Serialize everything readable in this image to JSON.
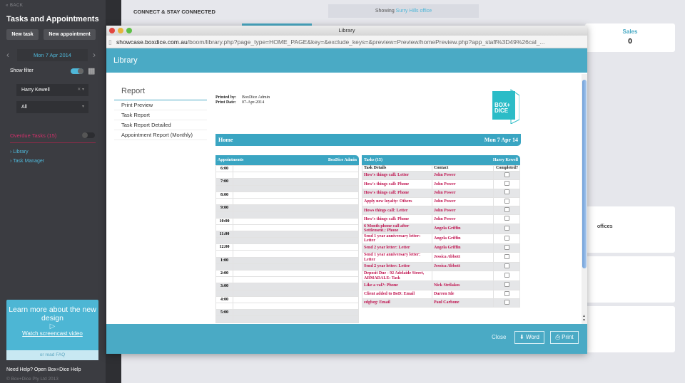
{
  "sidebar": {
    "back": "« BACK",
    "title": "Tasks and Appointments",
    "new_task": "New task",
    "new_appointment": "New appointment",
    "date": "Mon 7 Apr 2014",
    "show_filter": "Show filter",
    "staff_filter": "Harry Kewell",
    "type_filter": "All",
    "overdue": "Overdue Tasks (15)",
    "links": [
      "Library",
      "Task Manager"
    ],
    "promo": {
      "title": "Learn more about the new design",
      "video": "Watch screencast video",
      "faq": "or read FAQ"
    },
    "help": "Need Help? Open Box+Dice Help",
    "copyright": "© Box+Dice Pty Ltd 2013"
  },
  "main": {
    "header": "CONNECT & STAY CONNECTED",
    "showing_prefix": "Showing",
    "showing_office": "Surry Hills office",
    "sales_label": "Sales",
    "sales_value": "0",
    "offices_text": "offices"
  },
  "window": {
    "title": "Library",
    "url_domain": "showcase.boxdice.com.au",
    "url_path": "/boom/library.php?page_type=HOME_PAGE&key=&exclude_keys=&preview=Preview/homePreview.php?app_staff%3D49%26cal_...",
    "header": "Library",
    "nav": {
      "heading": "Report",
      "items": [
        "Print Preview",
        "Task Report",
        "Task Report Detailed",
        "Appointment Report (Monthly)"
      ]
    },
    "footer": {
      "close": "Close",
      "word": "Word",
      "print": "Print"
    }
  },
  "report": {
    "printed_by_label": "Printed by:",
    "printed_by": "BoxDice Admin",
    "print_date_label": "Print Date:",
    "print_date": "07-Apr-2014",
    "logo_text": "BOX+ DICE",
    "home": "Home",
    "date": "Mon 7 Apr 14",
    "appointments": {
      "title": "Appointments",
      "user": "BoxDice Admin",
      "hours": [
        "6:00",
        "7:00",
        "8:00",
        "9:00",
        "10:00",
        "11:00",
        "12:00",
        "1:00",
        "2:00",
        "3:00",
        "4:00",
        "5:00"
      ]
    },
    "tasks": {
      "title": "Tasks (15)",
      "user": "Harry Kewell",
      "columns": [
        "Task Details",
        "Contact",
        "Completed?"
      ],
      "rows": [
        {
          "task": "How's things call: Letter",
          "contact": "John Power",
          "completed": false
        },
        {
          "task": "How's things call: Phone",
          "contact": "John Power",
          "completed": false
        },
        {
          "task": "How's things call: Phone",
          "contact": "John Power",
          "completed": false
        },
        {
          "task": "Apply new loyalty: Others",
          "contact": "John Power",
          "completed": false
        },
        {
          "task": "Hows things call: Letter",
          "contact": "John Power",
          "completed": false
        },
        {
          "task": "How's things call: Phone",
          "contact": "John Power",
          "completed": false
        },
        {
          "task": "6 Month phone call after Settlement.: Phone",
          "contact": "Angela Griffin",
          "completed": false
        },
        {
          "task": "Send 1 year anniversary letter: Letter",
          "contact": "Angela Griffin",
          "completed": false
        },
        {
          "task": "Send 2 year letter: Letter",
          "contact": "Angela Griffin",
          "completed": false
        },
        {
          "task": "Send 1 year anniversary letter: Letter",
          "contact": "Jessica Abbott",
          "completed": false
        },
        {
          "task": "Send 2 year letter: Letter",
          "contact": "Jessica Abbott",
          "completed": false
        },
        {
          "task": "Deposit Due - 92 Adelaide Street, ARMADALE: Task",
          "contact": "",
          "completed": false
        },
        {
          "task": "Like a val?: Phone",
          "contact": "Nick Strilakos",
          "completed": false
        },
        {
          "task": "Client added to BoD: Email",
          "contact": "Darren Ide",
          "completed": false
        },
        {
          "task": "edgbeg: Email",
          "contact": "Paul Carbone",
          "completed": false
        }
      ]
    }
  },
  "colors": {
    "accent": "#4aaac5",
    "overdue": "#d0306a",
    "task_text": "#c0134f"
  }
}
